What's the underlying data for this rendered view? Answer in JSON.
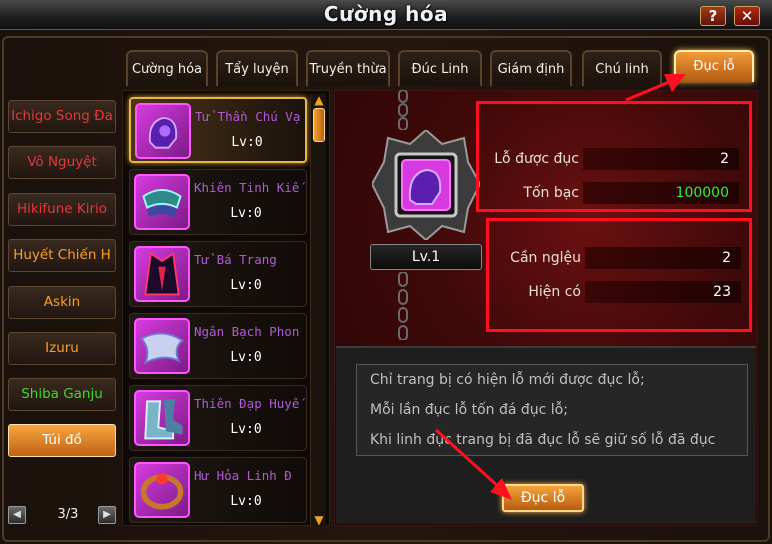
{
  "window": {
    "title": "Cường hóa",
    "help_label": "?",
    "close_label": "✕"
  },
  "tabs": [
    {
      "label": "Cường hóa"
    },
    {
      "label": "Tẩy luyện"
    },
    {
      "label": "Truyền thừa"
    },
    {
      "label": "Đúc Linh"
    },
    {
      "label": "Giám định"
    },
    {
      "label": "Chú linh"
    },
    {
      "label": "Đục lỗ"
    }
  ],
  "active_tab": "Đục lỗ",
  "characters": [
    {
      "name": "Ichigo Song Đa",
      "color": "#e03a3a"
    },
    {
      "name": "Vô Nguyệt",
      "color": "#e03a3a"
    },
    {
      "name": "Hikifune Kirio",
      "color": "#e03a3a"
    },
    {
      "name": "Huyết Chiến H",
      "color": "#ff9d1f"
    },
    {
      "name": "Askin",
      "color": "#ff9d1f"
    },
    {
      "name": "Izuru",
      "color": "#ff9d1f"
    },
    {
      "name": "Shiba Ganju",
      "color": "#45d72e"
    },
    {
      "name": "Túi đồ",
      "color": "#ffffff"
    }
  ],
  "pager": {
    "text": "3/3"
  },
  "items": [
    {
      "name": "Tử Thần Chú Vạ",
      "level": "Lv:0"
    },
    {
      "name": "Khiên Tinh Kiế",
      "level": "Lv:0"
    },
    {
      "name": "Tử Bá Trang",
      "level": "Lv:0"
    },
    {
      "name": "Ngân Bạch Phon",
      "level": "Lv:0"
    },
    {
      "name": "Thiên Đạp Huyế",
      "level": "Lv:0"
    },
    {
      "name": "Hư Hỏa Linh Đ",
      "level": "Lv:0"
    }
  ],
  "equipped": {
    "level_label": "Lv.1"
  },
  "info_top": {
    "holes_label": "Lỗ được đục",
    "holes_value": "2",
    "cost_label": "Tốn bạc",
    "cost_value": "100000"
  },
  "info_bottom": {
    "need_label": "Cần nglệu",
    "need_value": "2",
    "have_label": "Hiện có",
    "have_value": "23"
  },
  "description": [
    "Chỉ trang bị có hiện lỗ mới được đục lỗ;",
    "Mỗi lần đục lỗ tốn đá đục lỗ;",
    "Khi linh đục trang bị đã đục lỗ sẽ giữ số lỗ đã đục"
  ],
  "action_button": {
    "label": "Đục lỗ"
  },
  "colors": {
    "highlight": "#ff0f1f",
    "cost_value": "#2ff22f",
    "item_name": "#b05ad8"
  }
}
